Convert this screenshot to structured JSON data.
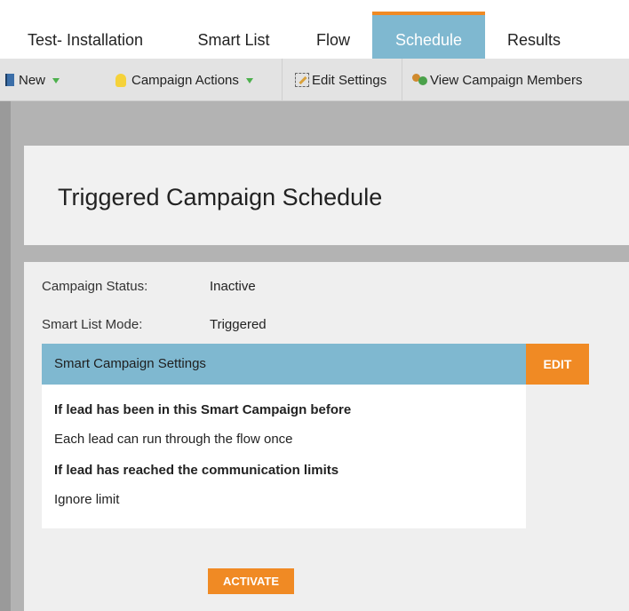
{
  "tabs": [
    {
      "label": "Test- Installation"
    },
    {
      "label": "Smart List"
    },
    {
      "label": "Flow"
    },
    {
      "label": "Schedule",
      "active": true
    },
    {
      "label": "Results"
    }
  ],
  "toolbar": {
    "new_label": "New",
    "campaign_actions_label": "Campaign Actions",
    "edit_settings_label": "Edit Settings",
    "view_members_label": "View Campaign Members"
  },
  "page": {
    "title": "Triggered Campaign Schedule"
  },
  "status": {
    "campaign_status_label": "Campaign Status:",
    "campaign_status_value": "Inactive",
    "smart_list_mode_label": "Smart List Mode:",
    "smart_list_mode_value": "Triggered"
  },
  "settings": {
    "header": "Smart Campaign Settings",
    "edit_label": "EDIT",
    "lines": [
      {
        "text": "If lead has been in this Smart Campaign before",
        "bold": true
      },
      {
        "text": "Each lead can run through the flow once",
        "bold": false
      },
      {
        "text": "If lead has reached the communication limits",
        "bold": true
      },
      {
        "text": "Ignore limit",
        "bold": false
      }
    ]
  },
  "activate_label": "ACTIVATE",
  "colors": {
    "accent_orange": "#f08a24",
    "tab_active_blue": "#7fb8d0",
    "toolbar_gray": "#e3e3e3",
    "workspace_gray": "#b3b3b3"
  },
  "icons": {
    "new": "notebook-icon",
    "campaign_actions": "lightbulb-icon",
    "edit_settings": "pencil-edit-icon",
    "view_members": "people-icon"
  }
}
